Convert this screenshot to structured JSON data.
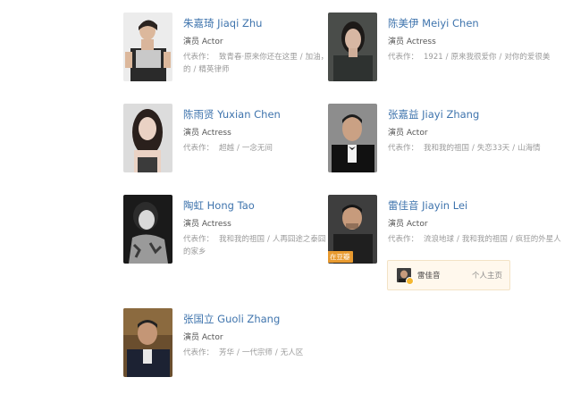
{
  "works_label": "代表作：",
  "actors": [
    {
      "name": "朱嘉琦 Jiaqi Zhu",
      "role": "演员 Actor",
      "works": [
        "致青春·原来你还在这里",
        "加油，你是最棒的",
        "精英律师"
      ]
    },
    {
      "name": "陈美伊 Meiyi Chen",
      "role": "演员 Actress",
      "works": [
        "1921",
        "原来我很爱你",
        "对你的爱很美"
      ]
    },
    {
      "name": "陈雨贤 Yuxian Chen",
      "role": "演员 Actress",
      "works": [
        "超越",
        "一念无间"
      ]
    },
    {
      "name": "张嘉益 Jiayi Zhang",
      "role": "演员 Actor",
      "works": [
        "我和我的祖国",
        "失恋33天",
        "山海情"
      ]
    },
    {
      "name": "陶虹 Hong Tao",
      "role": "演员 Actress",
      "works": [
        "我和我的祖国",
        "人再囧途之泰囧",
        "我和我的家乡"
      ]
    },
    {
      "name": "雷佳音 Jiayin Lei",
      "role": "演员 Actor",
      "badge": "在豆瓣",
      "works": [
        "流浪地球",
        "我和我的祖国",
        "疯狂的外星人"
      ]
    },
    {
      "name": "张国立 Guoli Zhang",
      "role": "演员 Actor",
      "works": [
        "芳华",
        "一代宗师",
        "无人区"
      ]
    }
  ],
  "profile_popup": {
    "name": "雷佳音",
    "link": "个人主页"
  }
}
